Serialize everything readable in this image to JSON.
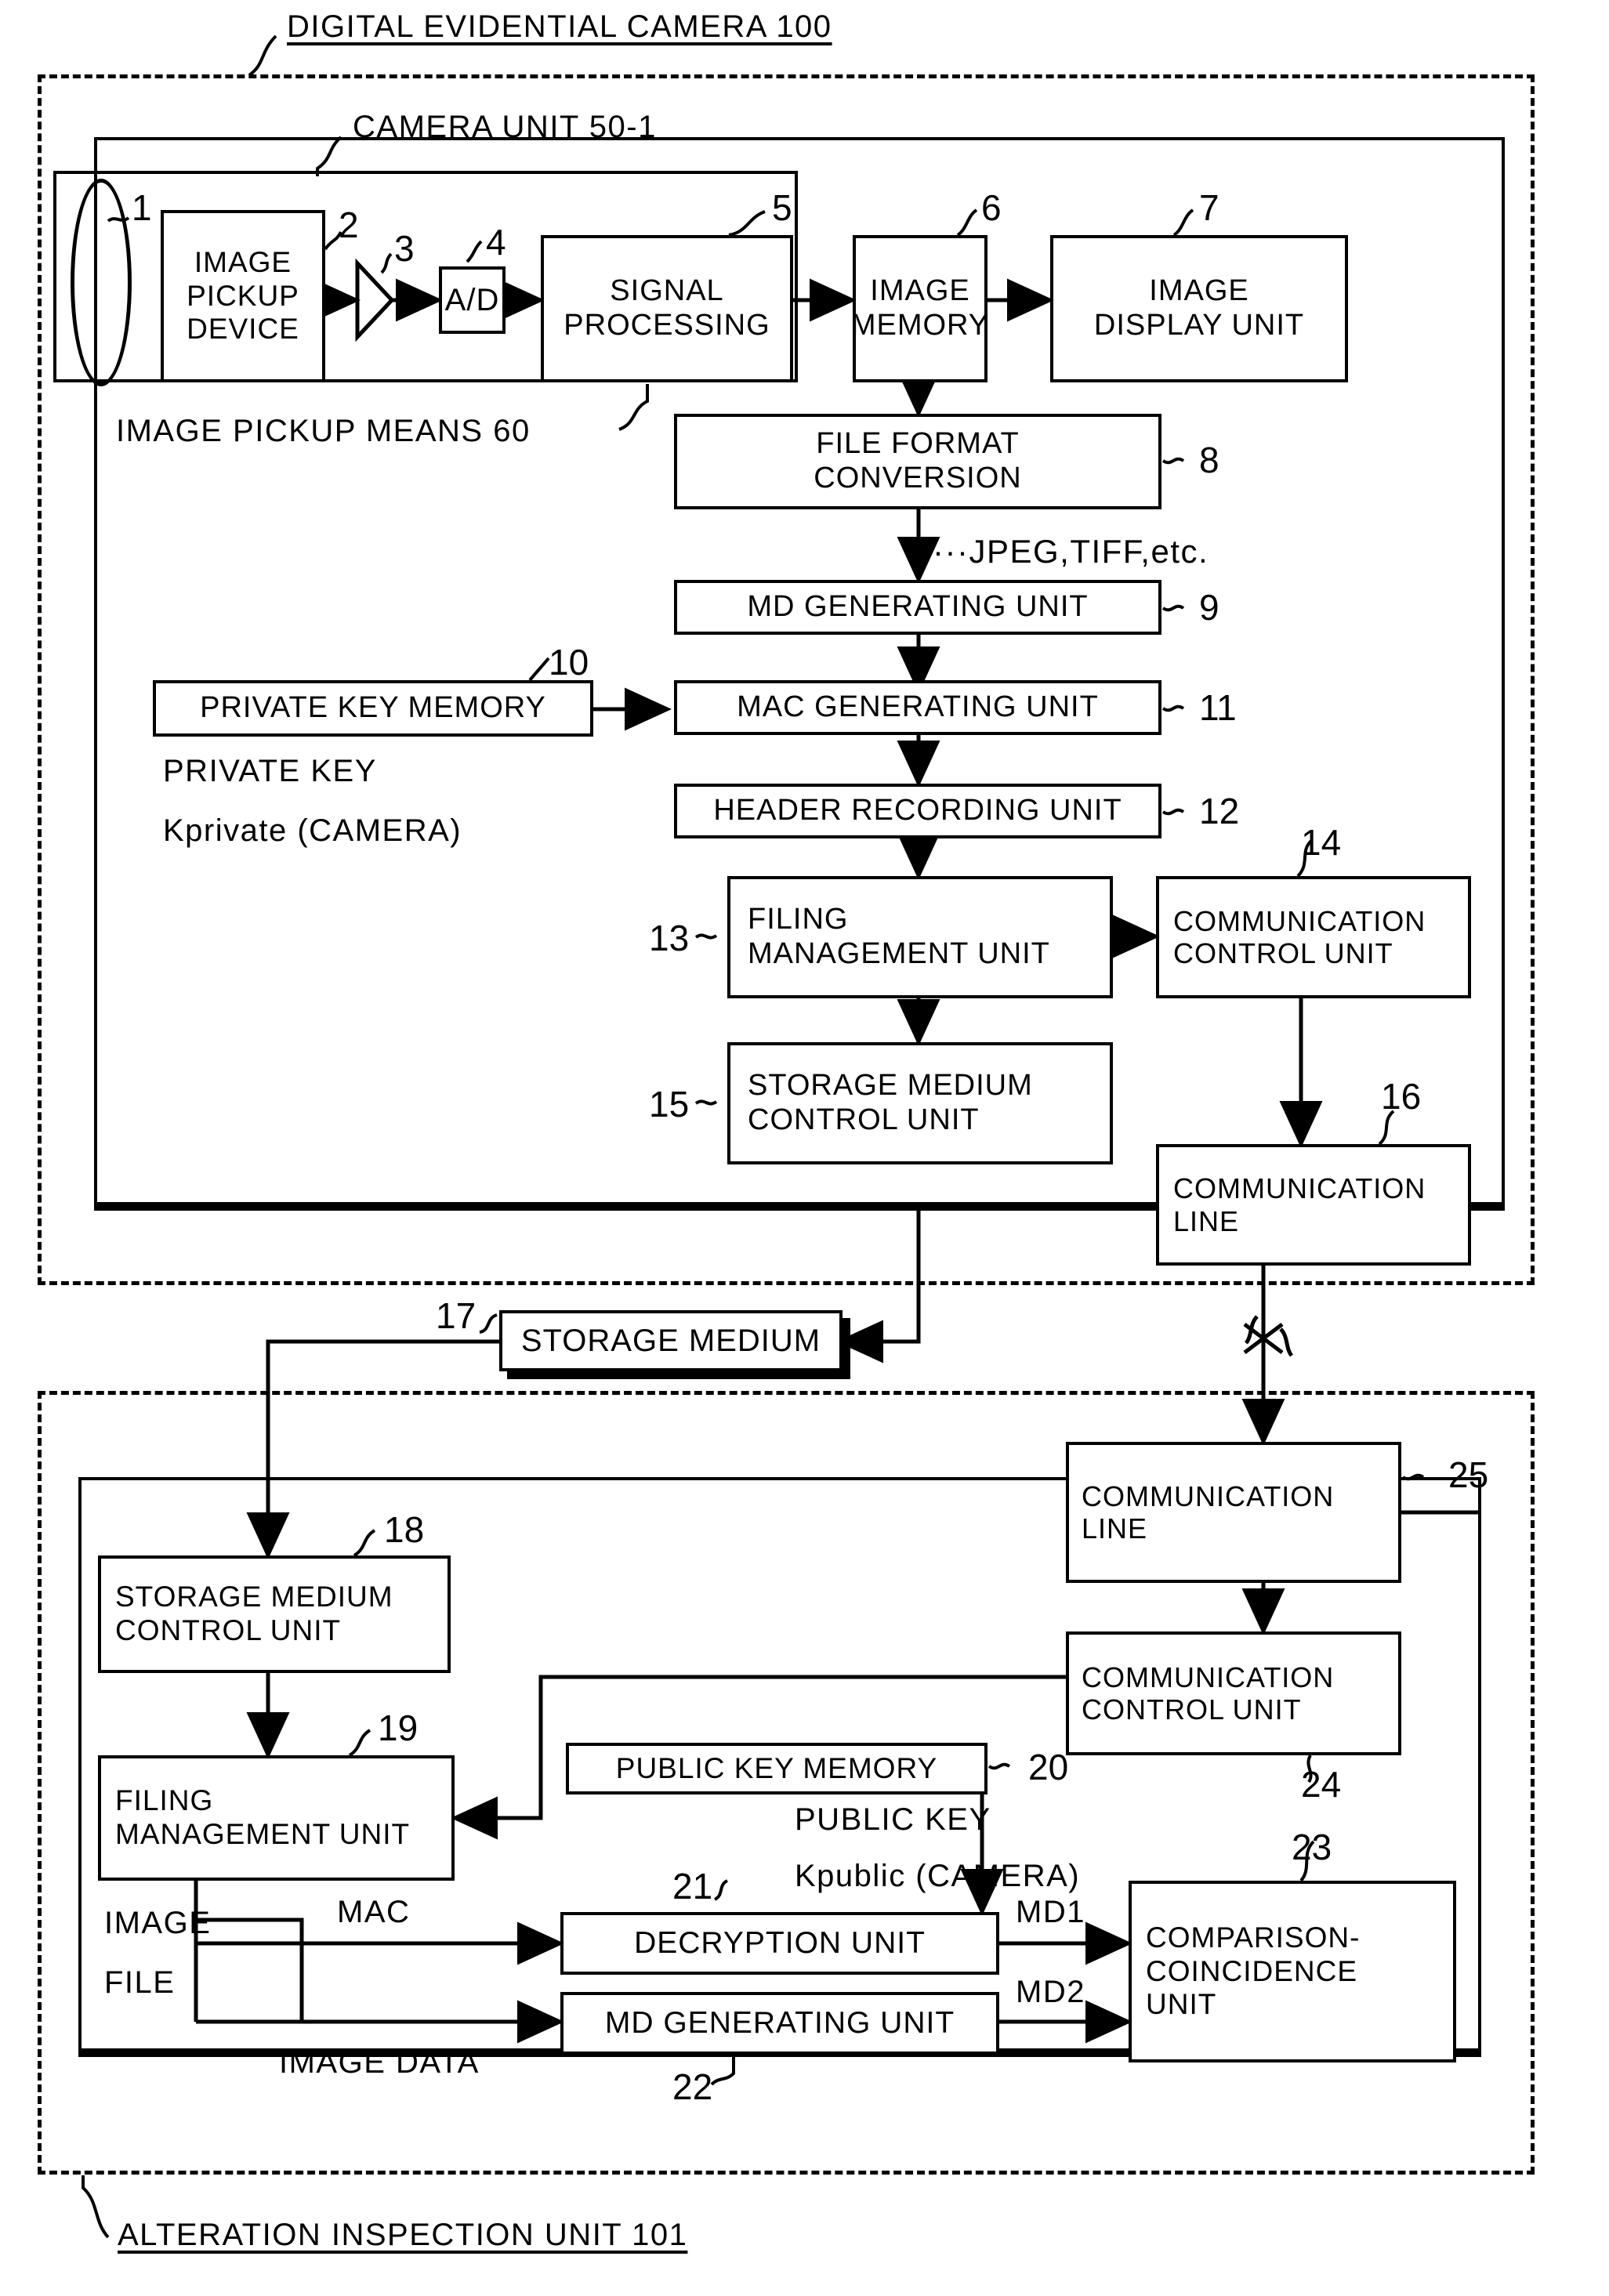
{
  "figure": {
    "outer_label": "DIGITAL EVIDENTIAL CAMERA 100",
    "camera_unit_label": "CAMERA UNIT 50-1",
    "image_pickup_means_label": "IMAGE PICKUP MEANS 60",
    "bottom_label": "ALTERATION INSPECTION UNIT 101"
  },
  "camera": {
    "lens_num": "1",
    "pickup": {
      "line1": "IMAGE",
      "line2": "PICKUP",
      "line3": "DEVICE",
      "num": "2"
    },
    "amp_num": "3",
    "ad": {
      "label": "A/D",
      "num": "4"
    },
    "signal": {
      "line1": "SIGNAL",
      "line2": "PROCESSING",
      "num": "5"
    },
    "image_memory": {
      "line1": "IMAGE",
      "line2": "MEMORY",
      "num": "6"
    },
    "image_display": {
      "line1": "IMAGE",
      "line2": "DISPLAY UNIT",
      "num": "7"
    },
    "file_format": {
      "line1": "FILE FORMAT",
      "line2": "CONVERSION",
      "num": "8"
    },
    "format_note": "···JPEG,TIFF,etc.",
    "md_generating": {
      "label": "MD GENERATING UNIT",
      "num": "9"
    },
    "private_key_memory": {
      "label": "PRIVATE KEY MEMORY",
      "num": "10"
    },
    "private_key_note_1": "PRIVATE KEY",
    "private_key_note_2": "Kprivate (CAMERA)",
    "mac_generating": {
      "label": "MAC GENERATING UNIT",
      "num": "11"
    },
    "header_recording": {
      "label": "HEADER RECORDING UNIT",
      "num": "12"
    },
    "filing_management": {
      "line1": "FILING",
      "line2": "MANAGEMENT UNIT",
      "num": "13"
    },
    "comm_control": {
      "line1": "COMMUNICATION",
      "line2": "CONTROL UNIT",
      "num": "14"
    },
    "storage_medium_control": {
      "line1": "STORAGE MEDIUM",
      "line2": "CONTROL UNIT",
      "num": "15"
    },
    "comm_line": {
      "line1": "COMMUNICATION",
      "line2": "LINE",
      "num": "16"
    }
  },
  "storage_medium": {
    "label": "STORAGE MEDIUM",
    "num": "17"
  },
  "inspection": {
    "comm_line": {
      "line1": "COMMUNICATION",
      "line2": "LINE",
      "num": "25"
    },
    "comm_control": {
      "line1": "COMMUNICATION",
      "line2": "CONTROL UNIT",
      "num": "24"
    },
    "storage_medium_control": {
      "line1": "STORAGE MEDIUM",
      "line2": "CONTROL UNIT",
      "num": "18"
    },
    "filing_management": {
      "line1": "FILING",
      "line2": "MANAGEMENT UNIT",
      "num": "19"
    },
    "public_key_memory": {
      "label": "PUBLIC KEY MEMORY",
      "num": "20"
    },
    "public_key_note_1": "PUBLIC KEY",
    "public_key_note_2": "Kpublic (CAMERA)",
    "image_file_note_1": "IMAGE",
    "image_file_note_2": "FILE",
    "mac_note": "MAC",
    "image_data_note": "IMAGE DATA",
    "decryption": {
      "label": "DECRYPTION UNIT",
      "num": "21"
    },
    "md_generating": {
      "label": "MD GENERATING UNIT",
      "num": "22"
    },
    "md1_note": "MD1",
    "md2_note": "MD2",
    "comparison": {
      "line1": "COMPARISON-",
      "line2": "COINCIDENCE",
      "line3": "UNIT",
      "num": "23"
    }
  },
  "colors": {
    "ink": "#000000",
    "paper": "#ffffff"
  }
}
